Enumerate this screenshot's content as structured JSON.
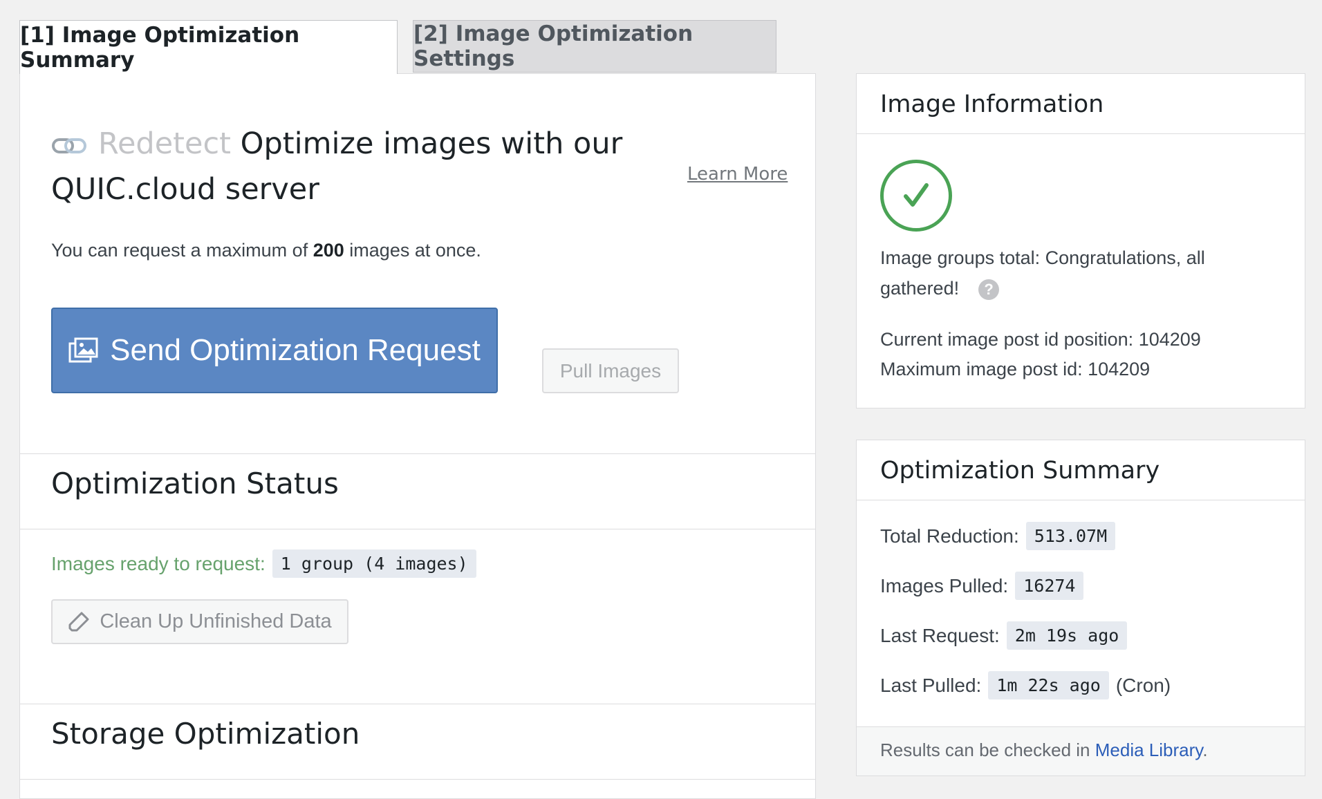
{
  "tabs": [
    {
      "label": "[1] Image Optimization Summary",
      "active": true
    },
    {
      "label": "[2] Image Optimization Settings",
      "active": false
    }
  ],
  "hero": {
    "link_icon": "link-chain-icon",
    "redetect": "Redetect",
    "title": "Optimize images with our QUIC.cloud server",
    "learn_more": "Learn More"
  },
  "limit": {
    "prefix": "You can request a maximum of",
    "count": "200",
    "suffix": "images at once."
  },
  "buttons": {
    "send": "Send Optimization Request",
    "pull": "Pull Images",
    "cleanup": "Clean Up Unfinished Data"
  },
  "status": {
    "title": "Optimization Status",
    "ready_label": "Images ready to request:",
    "ready_value": "1 group (4 images)"
  },
  "storage": {
    "title": "Storage Optimization"
  },
  "image_info": {
    "title": "Image Information",
    "groups_total": "Image groups total: Congratulations, all gathered!",
    "help": "?",
    "current_pos": "Current image post id position: 104209",
    "max_id": "Maximum image post id: 104209"
  },
  "summary": {
    "title": "Optimization Summary",
    "total_reduction_label": "Total Reduction:",
    "total_reduction": "513.07M",
    "images_pulled_label": "Images Pulled:",
    "images_pulled": "16274",
    "last_request_label": "Last Request:",
    "last_request": "2m 19s ago",
    "last_pulled_label": "Last Pulled:",
    "last_pulled": "1m 22s ago",
    "last_pulled_suffix": "(Cron)",
    "footer_prefix": "Results can be checked in",
    "footer_link": "Media Library",
    "footer_suffix": "."
  },
  "colors": {
    "primary_button": "#5b87c3",
    "success": "#4aa355",
    "ready_text": "#67a26d",
    "link": "#2c5eb8"
  }
}
